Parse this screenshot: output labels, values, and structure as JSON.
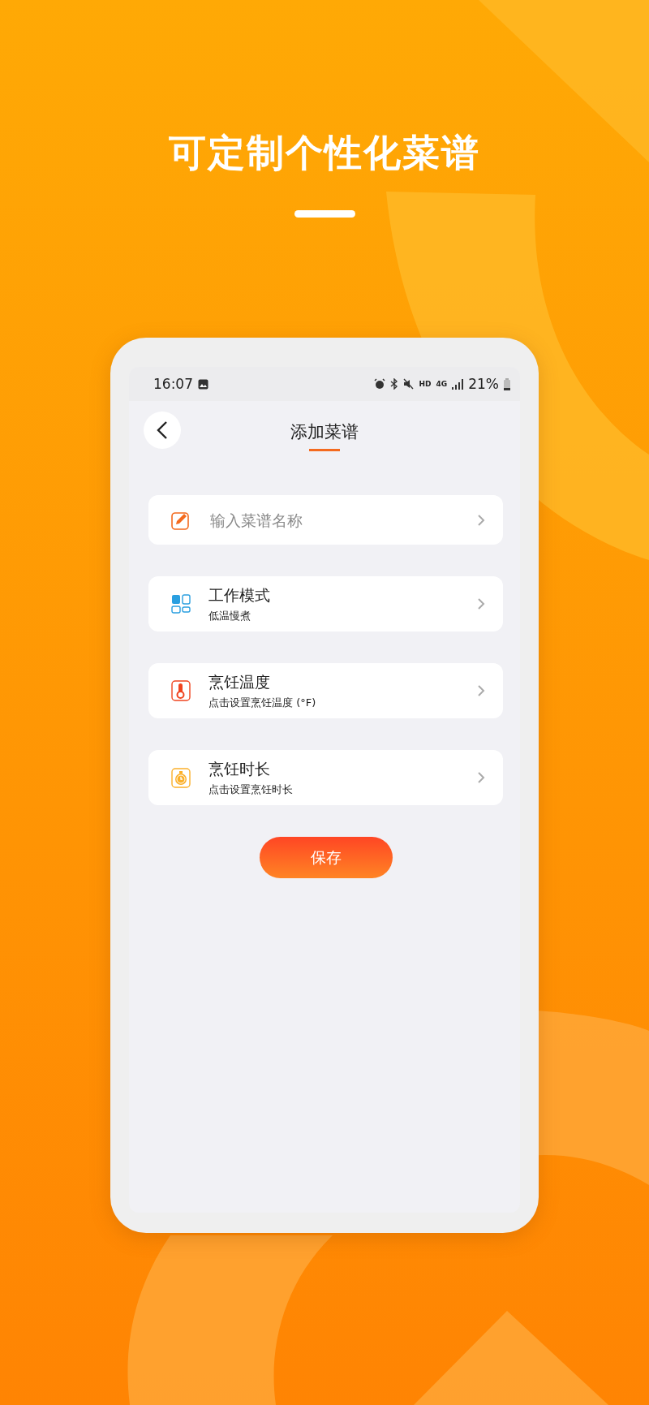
{
  "headline": "可定制个性化菜谱",
  "status_bar": {
    "time": "16:07",
    "network_label": "HD",
    "network_type": "4G",
    "battery": "21%"
  },
  "header": {
    "title": "添加菜谱"
  },
  "items": [
    {
      "kind": "input",
      "placeholder": "输入菜谱名称"
    },
    {
      "kind": "setting",
      "title": "工作模式",
      "subtitle": "低温慢煮"
    },
    {
      "kind": "setting",
      "title": "烹饪温度",
      "subtitle": "点击设置烹饪温度 (°F)"
    },
    {
      "kind": "setting",
      "title": "烹饪时长",
      "subtitle": "点击设置烹饪时长"
    }
  ],
  "save_button": "保存"
}
